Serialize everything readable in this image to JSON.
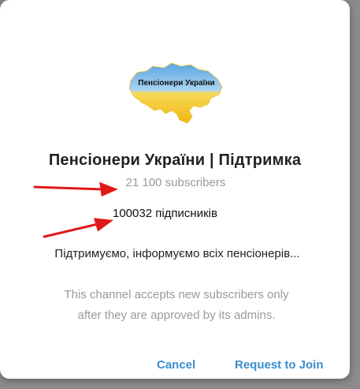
{
  "dialog": {
    "channel_logo_text": "Пенсіонери України",
    "title": "Пенсіонери України | Підтримка",
    "subscribers": "21 100 subscribers",
    "annotation": "100032 підписників",
    "description": "Підтримуємо, інформуємо всіх пенсіонерів...",
    "notice_line1": "This channel accepts new subscribers only",
    "notice_line2": "after they are approved by its admins.",
    "cancel_label": "Cancel",
    "join_label": "Request to Join"
  },
  "colors": {
    "accent": "#3a8ecf",
    "annotation_arrow": "#e0191a",
    "map_blue": "#4a98d8",
    "map_yellow": "#f2c418"
  }
}
